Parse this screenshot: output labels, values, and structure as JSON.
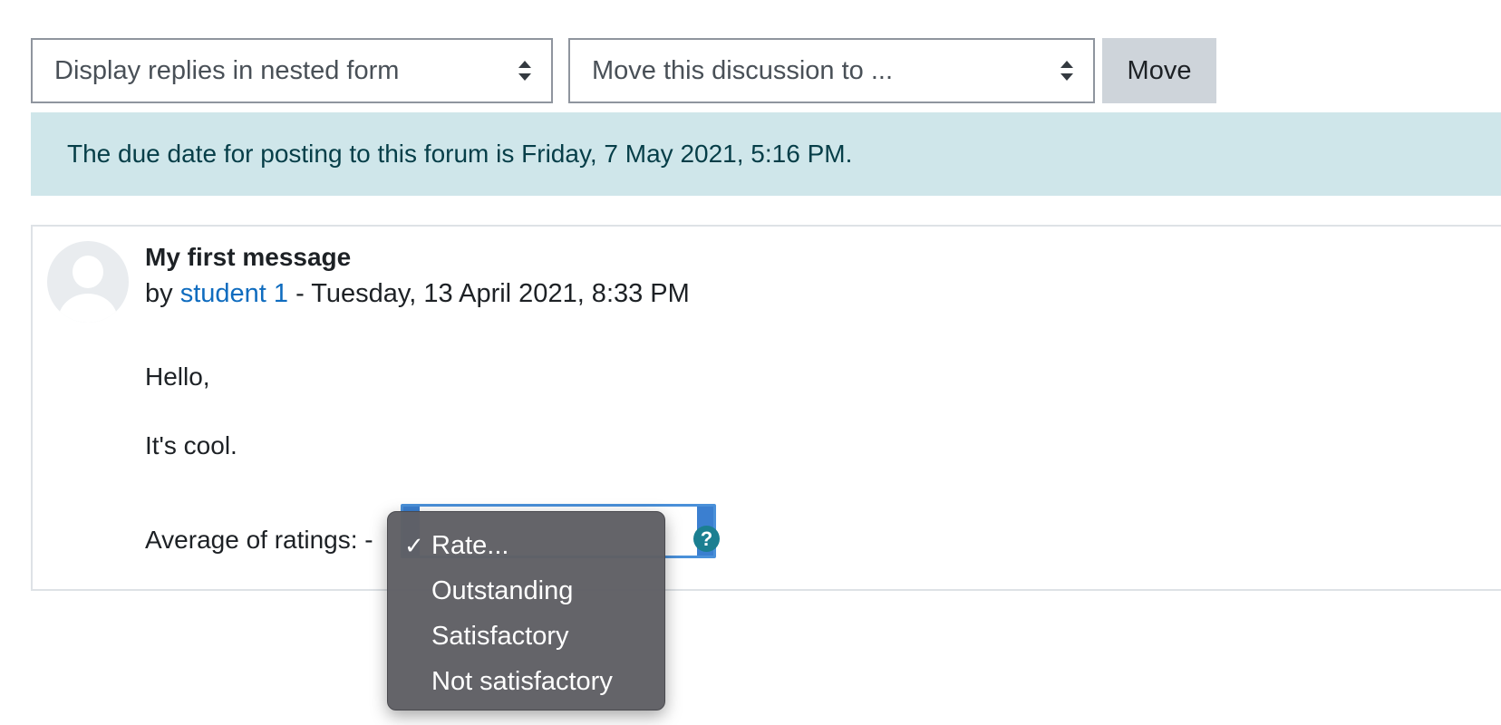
{
  "toolbar": {
    "display_mode": "Display replies in nested form",
    "move_select": "Move this discussion to ...",
    "move_button": "Move"
  },
  "alert": {
    "text": "The due date for posting to this forum is Friday, 7 May 2021, 5:16 PM."
  },
  "post": {
    "title": "My first message",
    "by": "by",
    "author": "student 1",
    "date": "- Tuesday, 13 April 2021, 8:33 PM",
    "message": [
      "Hello,",
      "It's cool."
    ],
    "rating_label": "Average of ratings: -"
  },
  "rating_dropdown": {
    "options": [
      {
        "label": "Rate...",
        "selected": true
      },
      {
        "label": "Outstanding",
        "selected": false
      },
      {
        "label": "Satisfactory",
        "selected": false
      },
      {
        "label": "Not satisfactory",
        "selected": false
      }
    ],
    "check_glyph": "✓"
  },
  "help": {
    "icon": "question-circle-icon",
    "glyph": "?"
  },
  "colors": {
    "alert_bg": "#cfe6ea",
    "alert_text": "#063e48",
    "link": "#0f6cbf",
    "help_icon": "#1b7f91",
    "focus_border": "#4a90d9"
  }
}
